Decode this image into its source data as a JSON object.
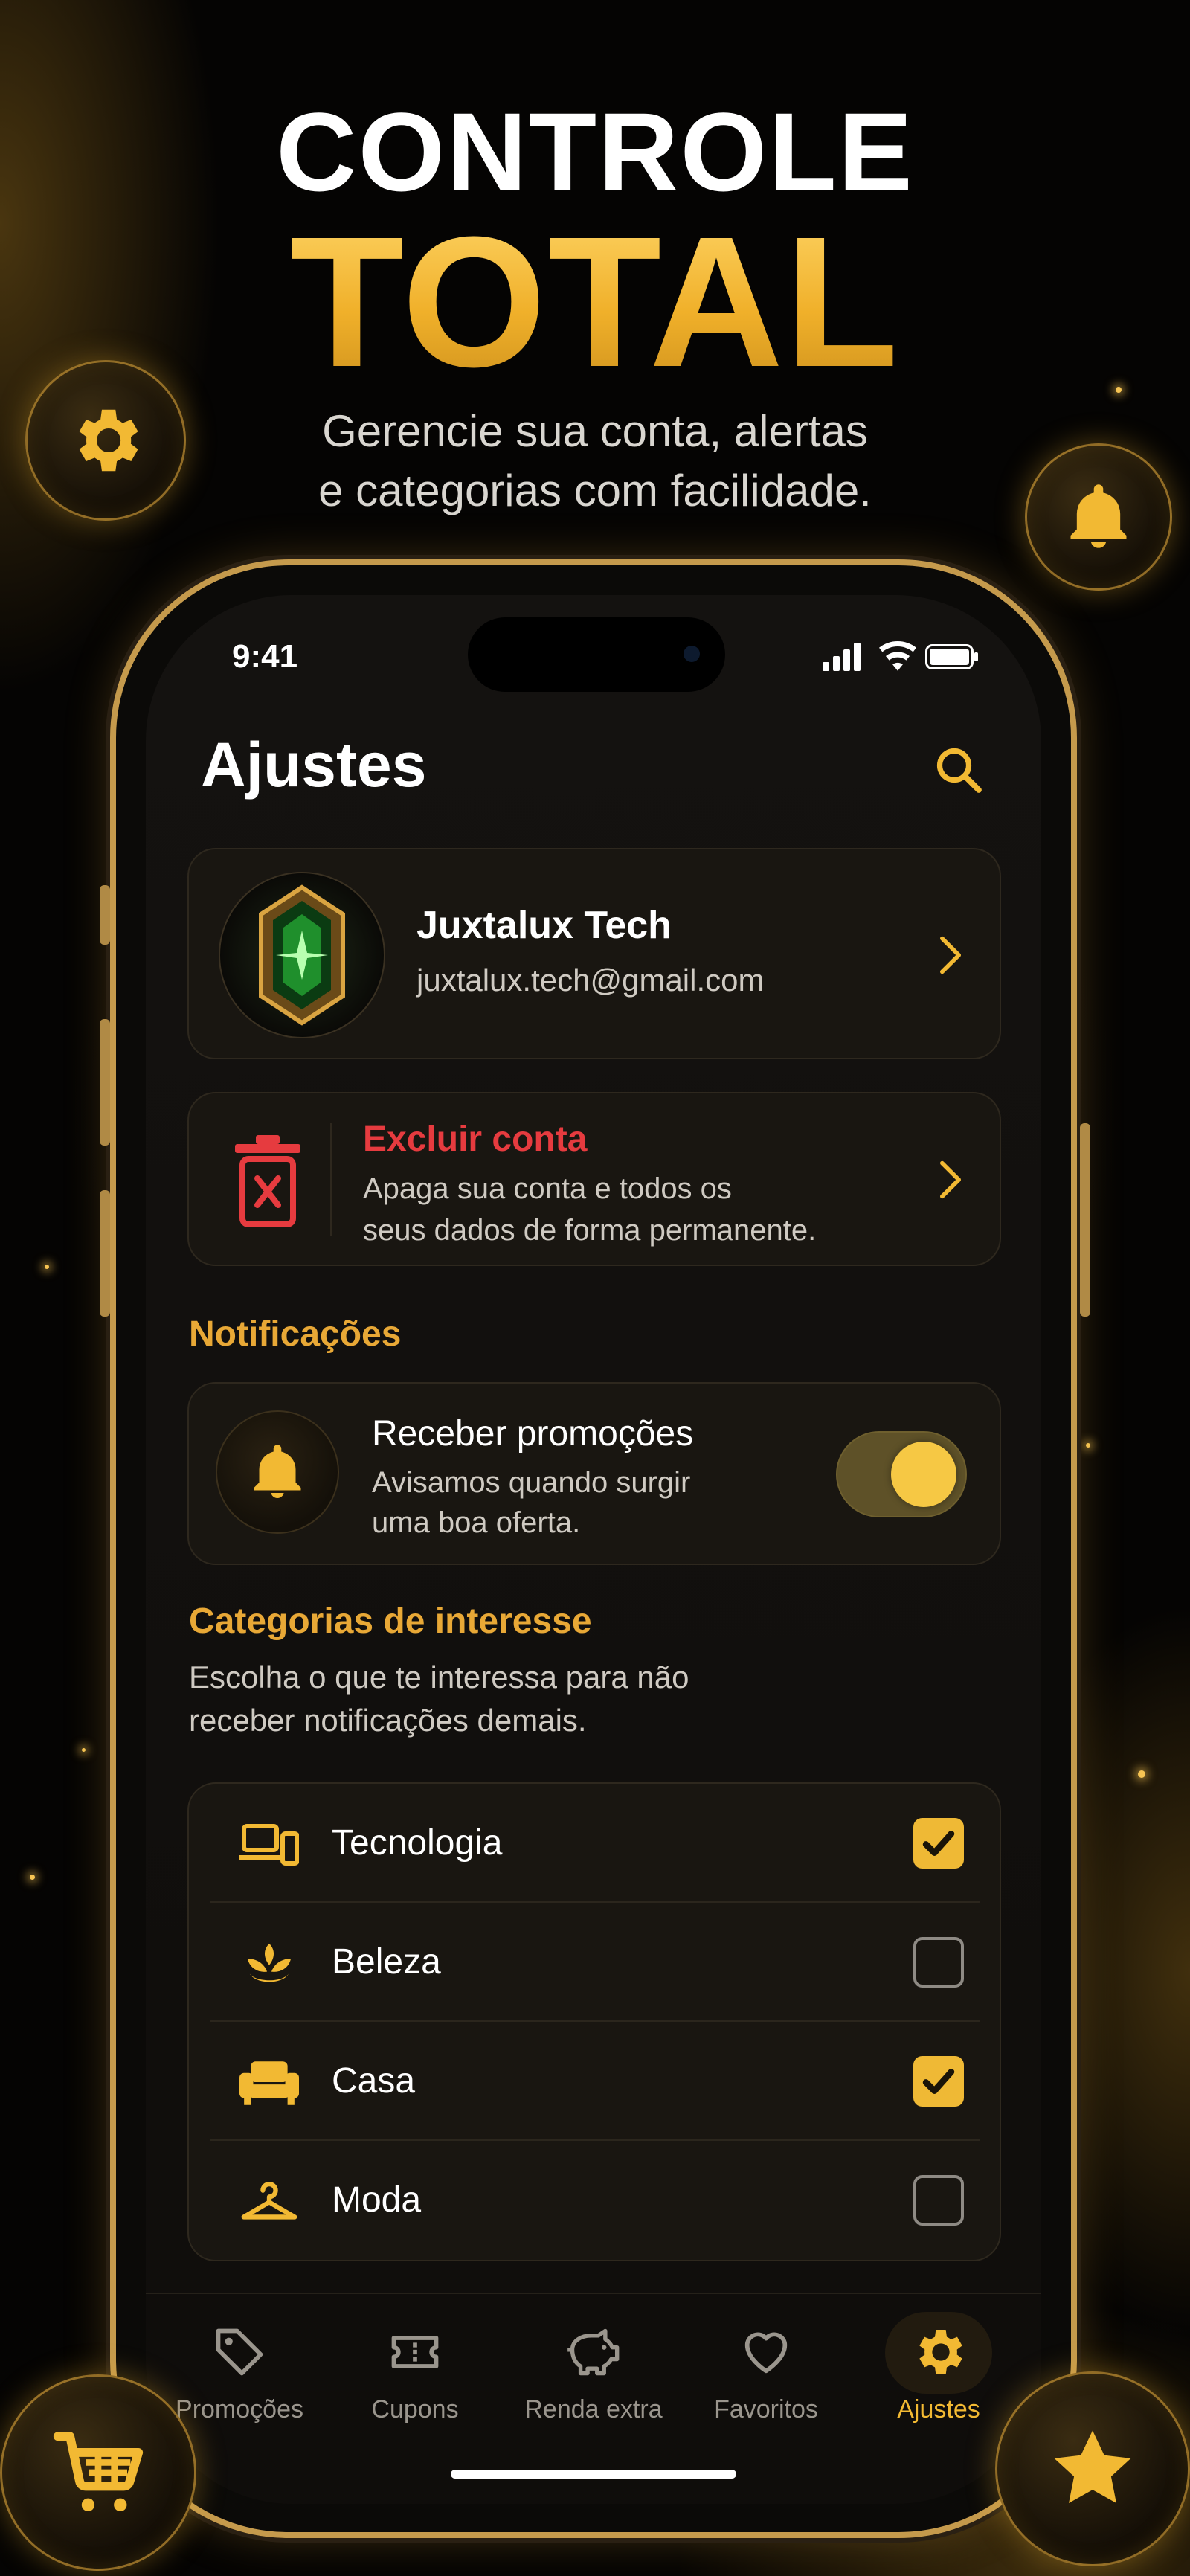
{
  "hero": {
    "line1": "CONTROLE",
    "line2": "TOTAL",
    "subtitle_line1": "Gerencie sua conta, alertas",
    "subtitle_line2": "e categorias com facilidade."
  },
  "decor_icons": [
    "gear-icon",
    "bell-icon",
    "cart-icon",
    "star-icon"
  ],
  "status_bar": {
    "time": "9:41",
    "icons": [
      "signal-icon",
      "wifi-icon",
      "battery-icon"
    ]
  },
  "header": {
    "title": "Ajustes",
    "search_icon": "search-icon"
  },
  "profile": {
    "name": "Juxtalux Tech",
    "email": "juxtalux.tech@gmail.com"
  },
  "delete_account": {
    "title": "Excluir conta",
    "desc_line1": "Apaga sua conta e todos os",
    "desc_line2": "seus dados de forma permanente."
  },
  "notifications": {
    "section_title": "Notificações",
    "title": "Receber promoções",
    "desc_line1": "Avisamos quando surgir",
    "desc_line2": "uma boa oferta.",
    "enabled": true
  },
  "categories": {
    "section_title": "Categorias de interesse",
    "desc_line1": "Escolha o que te interessa para não",
    "desc_line2": "receber notificações demais.",
    "items": [
      {
        "label": "Tecnologia",
        "icon": "devices-icon",
        "checked": true
      },
      {
        "label": "Beleza",
        "icon": "lotus-icon",
        "checked": false
      },
      {
        "label": "Casa",
        "icon": "sofa-icon",
        "checked": true
      },
      {
        "label": "Moda",
        "icon": "hanger-icon",
        "checked": false
      }
    ]
  },
  "tabs": [
    {
      "label": "Promoções",
      "icon": "tag-icon",
      "active": false
    },
    {
      "label": "Cupons",
      "icon": "ticket-icon",
      "active": false
    },
    {
      "label": "Renda extra",
      "icon": "piggy-bank-icon",
      "active": false
    },
    {
      "label": "Favoritos",
      "icon": "heart-icon",
      "active": false
    },
    {
      "label": "Ajustes",
      "icon": "gear-icon",
      "active": true
    }
  ],
  "colors": {
    "accent": "#f2b933",
    "danger": "#e63b3f",
    "background": "#0f0d0b",
    "card": "#191611"
  }
}
